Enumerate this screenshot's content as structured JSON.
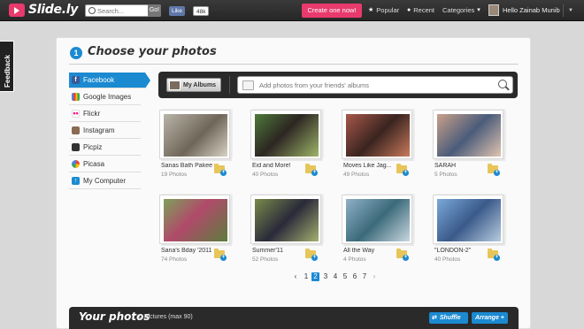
{
  "brand": {
    "name": "Slide.ly"
  },
  "header": {
    "search_placeholder": "Search...",
    "search_go": "Go!",
    "like_label": "Like",
    "like_count": "48k",
    "create_label": "Create one now!",
    "nav": {
      "popular": "Popular",
      "recent": "Recent",
      "categories": "Categories"
    },
    "greeting": "Hello Zainab Munib"
  },
  "feedback_label": "Feedback",
  "step": {
    "number": "1",
    "title": "Choose your photos"
  },
  "sources": [
    {
      "label": "Facebook",
      "icon": "facebook-icon",
      "active": true
    },
    {
      "label": "Google Images",
      "icon": "google-images-icon",
      "active": false
    },
    {
      "label": "Flickr",
      "icon": "flickr-icon",
      "active": false
    },
    {
      "label": "Instagram",
      "icon": "instagram-icon",
      "active": false
    },
    {
      "label": "Picpiz",
      "icon": "picpiz-icon",
      "active": false
    },
    {
      "label": "Picasa",
      "icon": "picasa-icon",
      "active": false
    },
    {
      "label": "My Computer",
      "icon": "upload-icon",
      "active": false
    }
  ],
  "toolbar": {
    "my_albums_label": "My Albums",
    "search_placeholder": "Add photos from your friends' albums"
  },
  "albums": [
    {
      "name": "Sanas Bath Pakee",
      "count": "19 Photos"
    },
    {
      "name": "Eid and More!",
      "count": "40 Photos"
    },
    {
      "name": "Moves Like Jag...",
      "count": "49 Photos"
    },
    {
      "name": "SARAH",
      "count": "5 Photos"
    },
    {
      "name": "Sana's Bday '2011",
      "count": "74 Photos"
    },
    {
      "name": "Summer'11",
      "count": "52 Photos"
    },
    {
      "name": "All the Way",
      "count": "4 Photos"
    },
    {
      "name": "\"LONDON-2\"",
      "count": "40 Photos"
    }
  ],
  "pagination": {
    "prev": "‹",
    "next": "›",
    "pages": [
      "1",
      "2",
      "3",
      "4",
      "5",
      "6",
      "7"
    ],
    "current": "2"
  },
  "your_photos": {
    "title": "Your photos",
    "count": "0 Pictures (max 90)",
    "shuffle_label": "Shuffle",
    "arrange_label": "Arrange +"
  },
  "colors": {
    "accent": "#1b8ad1",
    "brand_pink": "#e83a6c"
  }
}
